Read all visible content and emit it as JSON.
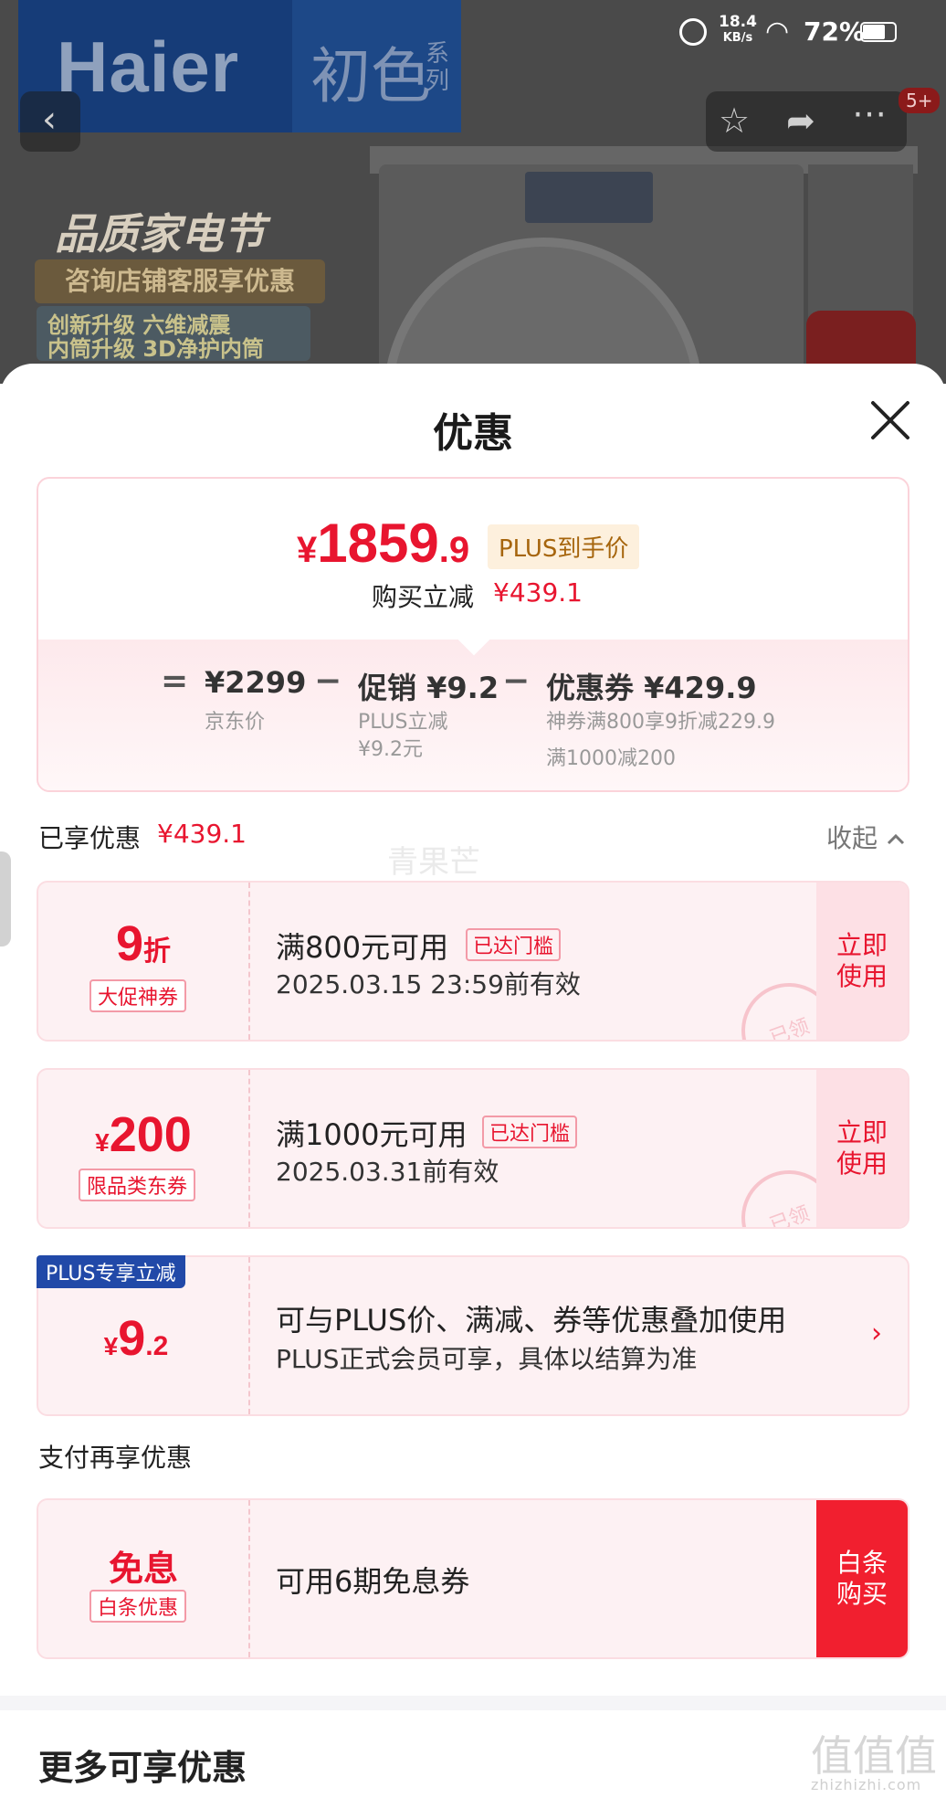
{
  "status_bar": {
    "speed_value": "18.4",
    "speed_unit": "KB/s",
    "battery": "72%"
  },
  "backdrop": {
    "brand": "Haier",
    "series": "初色",
    "series_tag": "系列",
    "promo_title": "品质家电节",
    "promo_sub": "咨询店铺客服享优惠",
    "promo_tags": "创新升级  六维减震\n内筒升级  3D净护内筒",
    "badge": "5+"
  },
  "sheet": {
    "title": "优惠"
  },
  "price_summary": {
    "currency": "¥",
    "final_int": "1859",
    "final_dec": ".9",
    "plus_tag": "PLUS到手价",
    "instant_label": "购买立减",
    "instant_amount": "¥439.1",
    "eq": "=",
    "minus": "−",
    "jd_price": "¥2299",
    "jd_label": "京东价",
    "promo_label": "促销 ¥9.2",
    "promo_sub1": "PLUS立减",
    "promo_sub2": "¥9.2元",
    "coupon_label": "优惠券 ¥429.9",
    "coupon_sub1": "神券满800享9折减229.9",
    "coupon_sub2": "满1000减200"
  },
  "enjoyed": {
    "label": "已享优惠",
    "amount": "¥439.1",
    "collapse": "收起",
    "watermark": "青果芒"
  },
  "coupons": [
    {
      "value_main": "9",
      "value_unit": "折",
      "tag": "大促神券",
      "condition": "满800元可用",
      "threshold": "已达门槛",
      "validity": "2025.03.15 23:59前有效",
      "use_line1": "立即",
      "use_line2": "使用",
      "stamp": "已领"
    },
    {
      "value_sym": "¥",
      "value_main": "200",
      "tag": "限品类东券",
      "condition": "满1000元可用",
      "threshold": "已达门槛",
      "validity": "2025.03.31前有效",
      "use_line1": "立即",
      "use_line2": "使用",
      "stamp": "已领"
    }
  ],
  "plus_coupon": {
    "badge": "PLUS专享立减",
    "value_sym": "¥",
    "value_int": "9",
    "value_dec": ".2",
    "line1": "可与PLUS价、满减、券等优惠叠加使用",
    "line2": "PLUS正式会员可享，具体以结算为准"
  },
  "pay_section": {
    "title": "支付再享优惠",
    "value": "免息",
    "tag": "白条优惠",
    "desc": "可用6期免息券",
    "button_line1": "白条",
    "button_line2": "购买"
  },
  "more": {
    "title": "更多可享优惠"
  },
  "site_watermark": {
    "mark": "值值值",
    "url": "zhizhizhi.com"
  },
  "colors": {
    "accent": "#e8152f",
    "plus_blue": "#2149a8",
    "coupon_bg": "#fdf1f3",
    "plus_gold_text": "#a6650d"
  }
}
